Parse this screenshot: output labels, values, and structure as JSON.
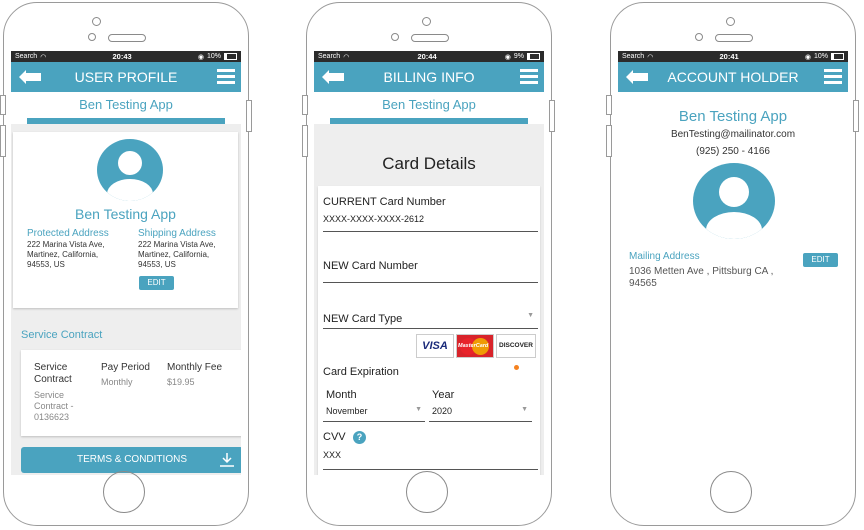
{
  "phone1": {
    "status": {
      "carrier": "Search",
      "time": "20:43",
      "battery": "10%"
    },
    "title": "USER PROFILE",
    "app_name": "Ben Testing App",
    "profile_name": "Ben Testing App",
    "protected_label": "Protected Address",
    "protected_address": "222 Marina Vista Ave, Martinez, California, 94553, US",
    "shipping_label": "Shipping Address",
    "shipping_address": "222 Marina Vista Ave, Martinez, California, 94553, US",
    "edit_label": "EDIT",
    "service_contract_heading": "Service Contract",
    "contract_col_label": "Service Contract",
    "contract_col_value": "Service Contract - 0136623",
    "pay_period_label": "Pay Period",
    "pay_period_value": "Monthly",
    "monthly_fee_label": "Monthly Fee",
    "monthly_fee_value": "$19.95",
    "terms_button": "TERMS & CONDITIONS"
  },
  "phone2": {
    "status": {
      "carrier": "Search",
      "time": "20:44",
      "battery": "9%"
    },
    "title": "BILLING INFO",
    "app_name": "Ben Testing App",
    "card_details": "Card Details",
    "current_card_label": "CURRENT Card Number",
    "current_card_value": "XXXX-XXXX-XXXX-2612",
    "new_card_label": "NEW Card Number",
    "new_card_type_label": "NEW Card Type",
    "card_logos": {
      "visa": "VISA",
      "mastercard": "MasterCard",
      "discover": "DISCOVER"
    },
    "expiration_label": "Card Expiration",
    "month_label": "Month",
    "month_value": "November",
    "year_label": "Year",
    "year_value": "2020",
    "cvv_label": "CVV",
    "cvv_help": "?",
    "cvv_value": "XXX"
  },
  "phone3": {
    "status": {
      "carrier": "Search",
      "time": "20:41",
      "battery": "10%"
    },
    "title": "ACCOUNT HOLDER",
    "app_name": "Ben Testing App",
    "email": "BenTesting@mailinator.com",
    "phone": "(925) 250 - 4166",
    "mailing_label": "Mailing Address",
    "mailing_address": "1036 Metten Ave , Pittsburg CA , 94565",
    "edit_label": "EDIT"
  },
  "colors": {
    "accent": "#4aa3bf",
    "statusbar": "#2b2b2b",
    "background": "#ffffff"
  }
}
